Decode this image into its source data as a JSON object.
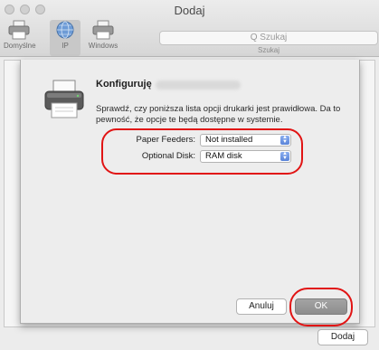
{
  "window": {
    "title": "Dodaj"
  },
  "toolbar": {
    "items": [
      {
        "label": "Domyślne",
        "icon": "printer-icon"
      },
      {
        "label": "IP",
        "icon": "globe-icon",
        "selected": true
      },
      {
        "label": "Windows",
        "icon": "printer-icon"
      }
    ],
    "search": {
      "placeholder": "Q Szukaj",
      "caption": "Szukaj"
    }
  },
  "sheet": {
    "title": "Konfiguruję",
    "description": "Sprawdź, czy poniższa lista opcji drukarki jest prawidłowa. Da to pewność, że opcje te będą dostępne w systemie.",
    "options": [
      {
        "label": "Paper Feeders:",
        "value": "Not installed"
      },
      {
        "label": "Optional Disk:",
        "value": "RAM disk"
      }
    ],
    "buttons": {
      "cancel": "Anuluj",
      "ok": "OK"
    }
  },
  "footer": {
    "add_button": "Dodaj"
  },
  "colors": {
    "annotation_red": "#e11414",
    "ok_button": "#9a9a9a",
    "popup_arrow_blue": "#5a84d8"
  }
}
